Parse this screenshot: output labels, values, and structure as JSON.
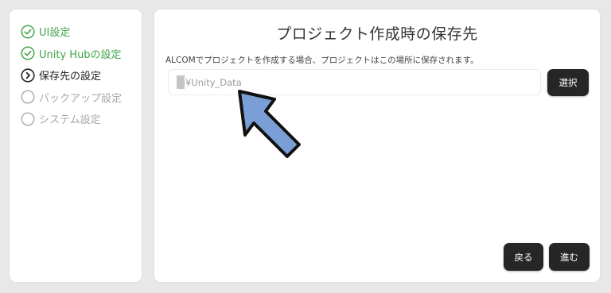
{
  "sidebar": {
    "steps": [
      {
        "label": "UI設定",
        "state": "done",
        "icon": "check-circle-icon"
      },
      {
        "label": "Unity Hubの設定",
        "state": "done",
        "icon": "check-circle-icon"
      },
      {
        "label": "保存先の設定",
        "state": "current",
        "icon": "chevron-right-circle-icon"
      },
      {
        "label": "バックアップ設定",
        "state": "pending",
        "icon": "empty-circle-icon"
      },
      {
        "label": "システム設定",
        "state": "pending",
        "icon": "empty-circle-icon"
      }
    ]
  },
  "main": {
    "title": "プロジェクト作成時の保存先",
    "description": "ALCOMでプロジェクトを作成する場合、プロジェクトはこの場所に保存されます。",
    "path_value": "¥Unity_Data",
    "select_label": "選択",
    "back_label": "戻る",
    "next_label": "進む"
  },
  "colors": {
    "done": "#3fa54a",
    "current": "#222222",
    "pending": "#a8a8a8",
    "button_bg": "#262626",
    "arrow_fill": "#7a9fd6"
  }
}
